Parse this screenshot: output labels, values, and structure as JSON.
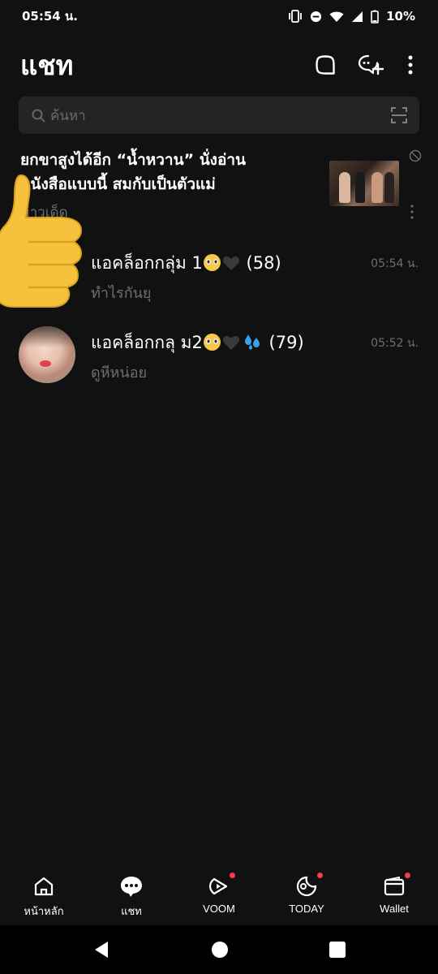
{
  "status_bar": {
    "time": "05:54 น.",
    "battery": "10%"
  },
  "header": {
    "title": "แชท"
  },
  "search": {
    "placeholder": "ค้นหา"
  },
  "ad": {
    "headline_line1": "ยกขาสูงได้อีก “น้ำหวาน” นั่งอ่าน",
    "headline_line2": "หนังสือแบบนี้ สมกับเป็นตัวแม่",
    "source": "ข่าวเด็ด"
  },
  "chats": [
    {
      "name_prefix": "แอคล็อกกลุ่ม 1",
      "count": "(58)",
      "preview": "ทำไรกันยุ",
      "time": "05:54 น."
    },
    {
      "name_prefix": "แอคล็อกกลุ ม2",
      "count": "(79)",
      "preview": "ดูหีหน่อย",
      "time": "05:52 น."
    }
  ],
  "bottom_nav": [
    {
      "label": "หน้าหลัก",
      "icon": "home-icon",
      "dot": false
    },
    {
      "label": "แชท",
      "icon": "chat-icon",
      "dot": false
    },
    {
      "label": "VOOM",
      "icon": "voom-icon",
      "dot": true
    },
    {
      "label": "TODAY",
      "icon": "today-icon",
      "dot": true
    },
    {
      "label": "Wallet",
      "icon": "wallet-icon",
      "dot": true
    }
  ],
  "colors": {
    "background": "#111111",
    "search_bg": "#242424",
    "muted_text": "#6f6f6f",
    "notification_dot": "#ff3b4a"
  }
}
